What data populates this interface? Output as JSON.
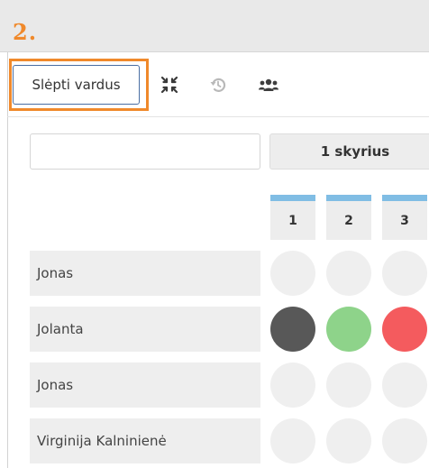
{
  "step_marker": "2.",
  "toolbar": {
    "hide_names_label": "Slėpti vardus",
    "icons": [
      "collapse-icon",
      "history-icon",
      "group-icon"
    ]
  },
  "search": {
    "value": "",
    "placeholder": ""
  },
  "chapter_button": "1 skyrius",
  "columns": [
    "1",
    "2",
    "3"
  ],
  "column_accent_color": "#80bde4",
  "highlight_color": "#f0892b",
  "students": [
    {
      "name": "Jonas",
      "marks": [
        "empty",
        "empty",
        "empty"
      ]
    },
    {
      "name": "Jolanta",
      "marks": [
        "dark",
        "green",
        "red"
      ]
    },
    {
      "name": "Jonas",
      "marks": [
        "empty",
        "empty",
        "empty"
      ]
    },
    {
      "name": "Virginija Kalninienė",
      "marks": [
        "empty",
        "empty",
        "empty"
      ]
    }
  ],
  "mark_colors": {
    "empty": "#efefef",
    "dark": "#585858",
    "green": "#8ed38a",
    "red": "#f45b5e"
  }
}
